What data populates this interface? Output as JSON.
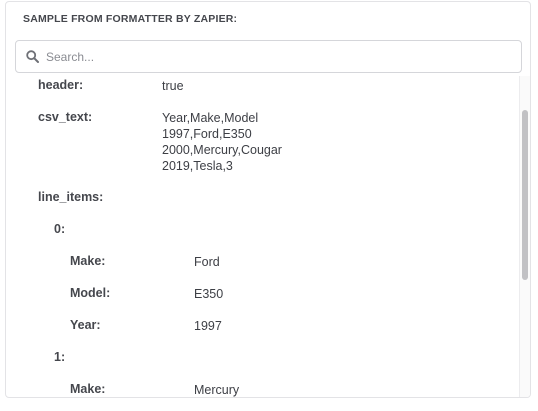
{
  "panel": {
    "title": "SAMPLE FROM FORMATTER BY ZAPIER:"
  },
  "search": {
    "placeholder": "Search...",
    "value": ""
  },
  "fields": {
    "header": {
      "key": "header:",
      "value": "true"
    },
    "csv_text": {
      "key": "csv_text:",
      "lines": [
        "Year,Make,Model",
        "1997,Ford,E350",
        "2000,Mercury,Cougar",
        "2019,Tesla,3"
      ]
    },
    "line_items": {
      "key": "line_items:",
      "items": [
        {
          "index": "0:",
          "make": {
            "key": "Make:",
            "value": "Ford"
          },
          "model": {
            "key": "Model:",
            "value": "E350"
          },
          "year": {
            "key": "Year:",
            "value": "1997"
          }
        },
        {
          "index": "1:",
          "make": {
            "key": "Make:",
            "value": "Mercury"
          }
        }
      ]
    }
  },
  "icons": {
    "search": "search-icon"
  }
}
